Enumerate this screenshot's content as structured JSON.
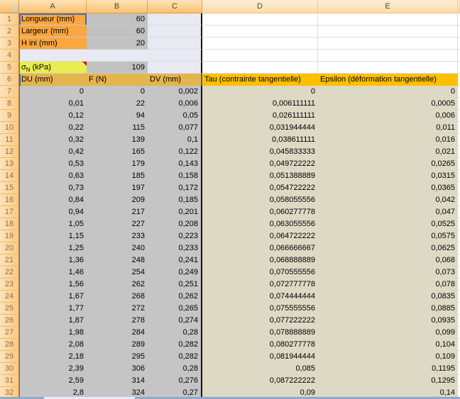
{
  "colors": {
    "label_orange": "#FBA63E",
    "label_yellow": "#E9ED50",
    "value_gray": "#C1C1C1",
    "light_lavender": "#E9E9F2",
    "header_gold": "#E4B44D",
    "header_orange": "#FFC000",
    "data_gray": "#C5C5C5",
    "data_tan": "#DDD9C5",
    "selection_blue": "#2F6BC4",
    "comment_red": "#E00000"
  },
  "column_headers": [
    "A",
    "B",
    "C",
    "D",
    "E"
  ],
  "row_numbers": [
    "1",
    "2",
    "3",
    "4",
    "5",
    "6",
    "7",
    "8",
    "9",
    "10",
    "11",
    "12",
    "13",
    "14",
    "15",
    "16",
    "17",
    "18",
    "19",
    "20",
    "21",
    "22",
    "23",
    "24",
    "25",
    "26",
    "27",
    "28",
    "29",
    "30",
    "31",
    "32"
  ],
  "params": [
    {
      "label": "Longueur (mm)",
      "value": "60",
      "comment": true,
      "style": "orange"
    },
    {
      "label": "Largeur (mm)",
      "value": "60",
      "comment": true,
      "style": "orange"
    },
    {
      "label": "H ini (mm)",
      "value": "20",
      "comment": true,
      "style": "orange"
    },
    {
      "label": "",
      "value": "",
      "comment": false,
      "style": "empty"
    },
    {
      "label_main": "σ",
      "label_sub": "N",
      "label_rest": " (kPa)",
      "value": "109",
      "comment": true,
      "style": "yellow"
    }
  ],
  "table_headers": [
    {
      "col": "A",
      "label": "DU (mm)",
      "comment": true
    },
    {
      "col": "B",
      "label": "F (N)",
      "comment": true
    },
    {
      "col": "C",
      "label": "DV (mm)",
      "comment": true
    },
    {
      "col": "D",
      "label": "Tau (contrainte tangentielle)",
      "comment": false
    },
    {
      "col": "E",
      "label": "Epsilon (déformation tangentielle)",
      "comment": false
    }
  ],
  "data_rows": [
    {
      "du": "0",
      "f": "0",
      "dv": "0,002",
      "tau": "0",
      "epsilon": "0"
    },
    {
      "du": "0,01",
      "f": "22",
      "dv": "0,006",
      "tau": "0,006111111",
      "epsilon": "0,0005"
    },
    {
      "du": "0,12",
      "f": "94",
      "dv": "0,05",
      "tau": "0,026111111",
      "epsilon": "0,006"
    },
    {
      "du": "0,22",
      "f": "115",
      "dv": "0,077",
      "tau": "0,031944444",
      "epsilon": "0,011"
    },
    {
      "du": "0,32",
      "f": "139",
      "dv": "0,1",
      "tau": "0,038611111",
      "epsilon": "0,016"
    },
    {
      "du": "0,42",
      "f": "165",
      "dv": "0,122",
      "tau": "0,045833333",
      "epsilon": "0,021"
    },
    {
      "du": "0,53",
      "f": "179",
      "dv": "0,143",
      "tau": "0,049722222",
      "epsilon": "0,0265"
    },
    {
      "du": "0,63",
      "f": "185",
      "dv": "0,158",
      "tau": "0,051388889",
      "epsilon": "0,0315"
    },
    {
      "du": "0,73",
      "f": "197",
      "dv": "0,172",
      "tau": "0,054722222",
      "epsilon": "0,0365"
    },
    {
      "du": "0,84",
      "f": "209",
      "dv": "0,185",
      "tau": "0,058055556",
      "epsilon": "0,042"
    },
    {
      "du": "0,94",
      "f": "217",
      "dv": "0,201",
      "tau": "0,060277778",
      "epsilon": "0,047"
    },
    {
      "du": "1,05",
      "f": "227",
      "dv": "0,208",
      "tau": "0,063055556",
      "epsilon": "0,0525"
    },
    {
      "du": "1,15",
      "f": "233",
      "dv": "0,223",
      "tau": "0,064722222",
      "epsilon": "0,0575"
    },
    {
      "du": "1,25",
      "f": "240",
      "dv": "0,233",
      "tau": "0,066666667",
      "epsilon": "0,0625"
    },
    {
      "du": "1,36",
      "f": "248",
      "dv": "0,241",
      "tau": "0,068888889",
      "epsilon": "0,068"
    },
    {
      "du": "1,46",
      "f": "254",
      "dv": "0,249",
      "tau": "0,070555556",
      "epsilon": "0,073"
    },
    {
      "du": "1,56",
      "f": "262",
      "dv": "0,251",
      "tau": "0,072777778",
      "epsilon": "0,078"
    },
    {
      "du": "1,67",
      "f": "268",
      "dv": "0,262",
      "tau": "0,074444444",
      "epsilon": "0,0835"
    },
    {
      "du": "1,77",
      "f": "272",
      "dv": "0,265",
      "tau": "0,075555556",
      "epsilon": "0,0885"
    },
    {
      "du": "1,87",
      "f": "278",
      "dv": "0,274",
      "tau": "0,077222222",
      "epsilon": "0,0935"
    },
    {
      "du": "1,98",
      "f": "284",
      "dv": "0,28",
      "tau": "0,078888889",
      "epsilon": "0,099"
    },
    {
      "du": "2,08",
      "f": "289",
      "dv": "0,282",
      "tau": "0,080277778",
      "epsilon": "0,104"
    },
    {
      "du": "2,18",
      "f": "295",
      "dv": "0,282",
      "tau": "0,081944444",
      "epsilon": "0,109"
    },
    {
      "du": "2,39",
      "f": "306",
      "dv": "0,28",
      "tau": "0,085",
      "epsilon": "0,1195"
    },
    {
      "du": "2,59",
      "f": "314",
      "dv": "0,276",
      "tau": "0,087222222",
      "epsilon": "0,1295"
    },
    {
      "du": "2,8",
      "f": "324",
      "dv": "0,27",
      "tau": "0,09",
      "epsilon": "0,14"
    }
  ]
}
